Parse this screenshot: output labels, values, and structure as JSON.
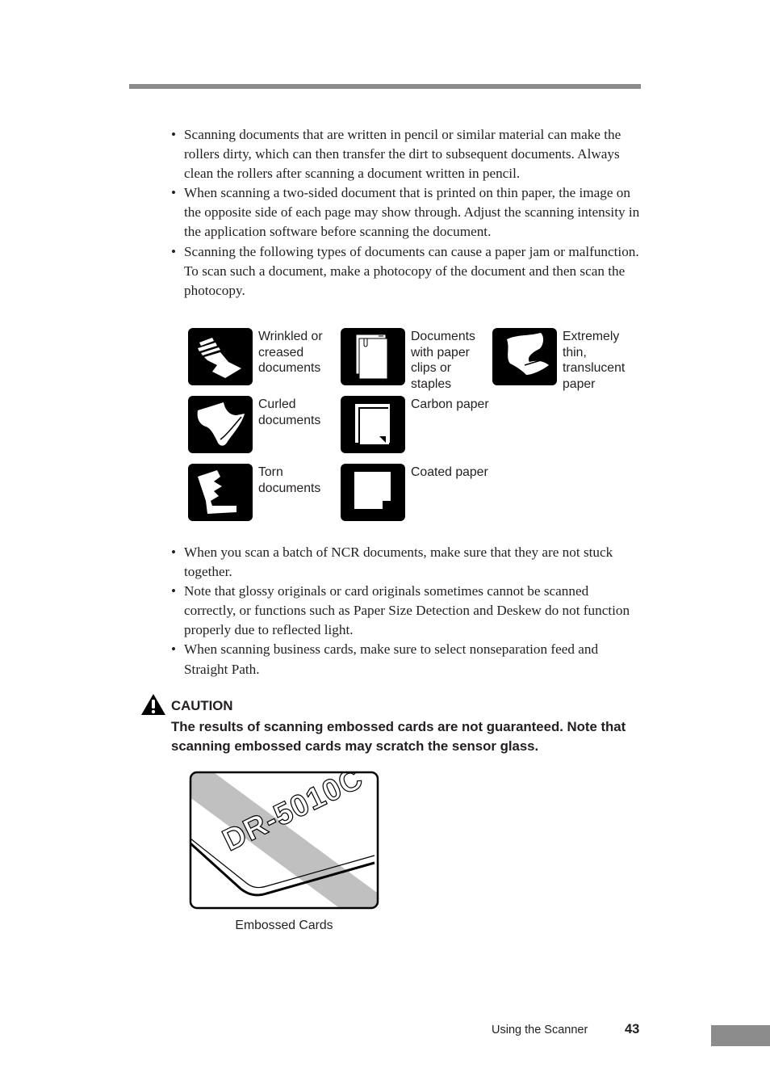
{
  "bullets_top": [
    {
      "marker": "•",
      "text": "Scanning documents that are written in pencil or similar material can make the rollers dirty, which can then transfer the dirt to subsequent documents. Always clean the rollers after scanning a document written in pencil."
    },
    {
      "marker": "•",
      "text": "When scanning a two-sided document that is printed on thin paper, the image on the opposite side of each page may show through. Adjust the scanning intensity in the application software before scanning the document."
    },
    {
      "marker": "•",
      "text": "Scanning the following types of documents can cause a paper jam or malfunction. To scan such a document, make a photocopy of the document and then scan the photocopy."
    }
  ],
  "document_types": [
    {
      "icon": "wrinkled-paper-icon",
      "label": "Wrinkled or creased documents"
    },
    {
      "icon": "paper-clip-icon",
      "label": "Documents with paper clips or staples"
    },
    {
      "icon": "thin-paper-icon",
      "label": "Extremely thin, translucent paper"
    },
    {
      "icon": "curled-paper-icon",
      "label": "Curled documents"
    },
    {
      "icon": "carbon-paper-icon",
      "label": "Carbon paper"
    },
    {
      "icon": "torn-paper-icon",
      "label": "Torn documents"
    },
    {
      "icon": "coated-paper-icon",
      "label": "Coated paper"
    }
  ],
  "bullets_bottom": [
    {
      "marker": "•",
      "text": "When you scan a batch of NCR documents, make sure that they are not stuck together."
    },
    {
      "marker": "•",
      "text": "Note that glossy originals or card originals sometimes cannot be scanned correctly, or functions such as Paper Size Detection and Deskew do not function properly due to reflected light."
    },
    {
      "marker": "•",
      "text": "When scanning business cards, make sure to select nonseparation feed and Straight Path."
    }
  ],
  "caution": {
    "icon": "warning-triangle-icon",
    "title": "CAUTION",
    "body": "The results of scanning embossed cards are not guaranteed. Note that scanning embossed cards may scratch the sensor glass."
  },
  "figure": {
    "embossed_text": "DR-5010C",
    "caption": "Embossed Cards"
  },
  "footer": {
    "section": "Using the Scanner",
    "page_number": "43"
  },
  "colors": {
    "rule_gray": "#8c8c8c",
    "text": "#231f20",
    "stripe_gray": "#c0c0c0"
  }
}
